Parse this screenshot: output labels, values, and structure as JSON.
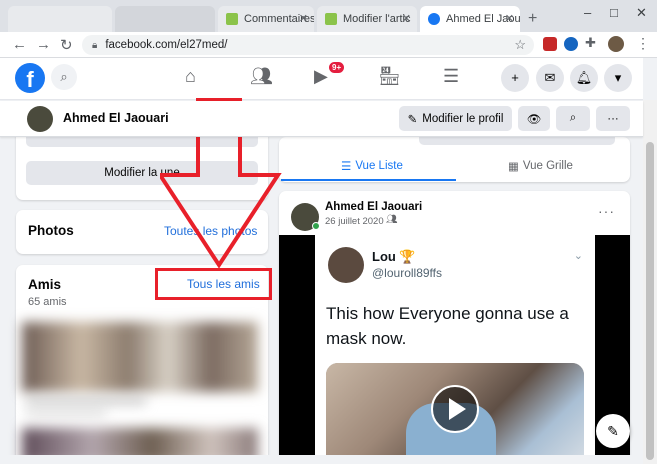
{
  "browser": {
    "tabs": [
      {
        "label": ""
      },
      {
        "label": "Commentaires"
      },
      {
        "label": "Modifier l'artic"
      },
      {
        "label": "Ahmed El Jaouari",
        "active": true
      }
    ],
    "url": "facebook.com/el27med/",
    "window_controls": [
      "–",
      "□",
      "✕"
    ]
  },
  "fb_nav": {
    "logo": "f",
    "notification_count": "9+"
  },
  "profile_header": {
    "name": "Ahmed El Jaouari",
    "edit_profile_label": "Modifier le profil"
  },
  "left": {
    "feature_button_label": "Modifier la une",
    "photos": {
      "title": "Photos",
      "link": "Toutes les photos"
    },
    "friends": {
      "title": "Amis",
      "count": "65 amis",
      "link": "Tous les amis"
    }
  },
  "right": {
    "view_tabs": [
      {
        "label": "Vue Liste",
        "selected": true
      },
      {
        "label": "Vue Grille",
        "selected": false
      }
    ],
    "post": {
      "author": "Ahmed El Jaouari",
      "date": "26 juillet 2020 ·",
      "tweet": {
        "user": "Lou 🏆",
        "handle": "@louroll89ffs",
        "text": "This how Everyone gonna use a mask now."
      }
    }
  },
  "colors": {
    "fb_blue": "#1877f2",
    "annotation_red": "#e8202a",
    "notif_red": "#e41e3f"
  }
}
